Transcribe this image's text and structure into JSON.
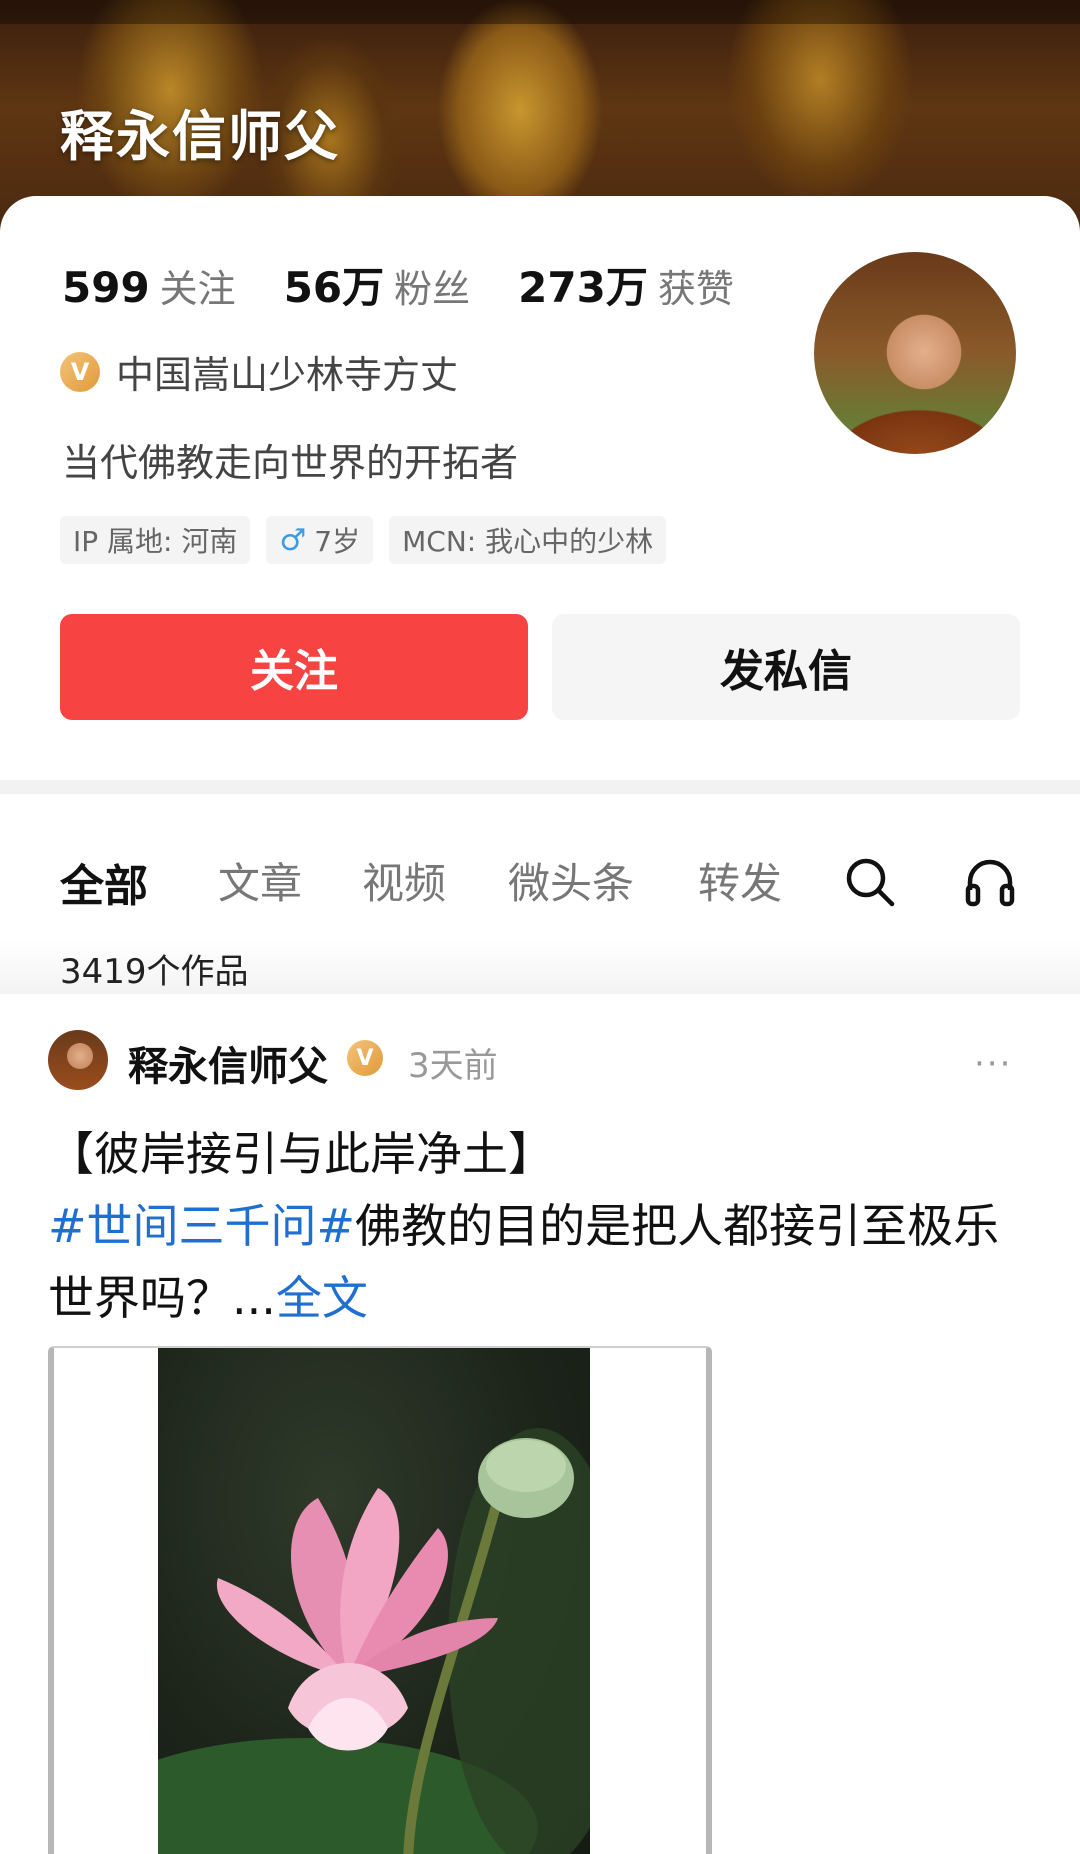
{
  "header": {
    "title": "释永信师父"
  },
  "profile": {
    "stats": [
      {
        "num": "599",
        "label": "关注"
      },
      {
        "num": "56万",
        "label": "粉丝"
      },
      {
        "num": "273万",
        "label": "获赞"
      }
    ],
    "verify_badge": "V",
    "verify_text": "中国嵩山少林寺方丈",
    "bio": "当代佛教走向世界的开拓者",
    "tags": {
      "ip": "IP 属地: 河南",
      "age": "7岁",
      "mcn": "MCN: 我心中的少林"
    },
    "follow_label": "关注",
    "message_label": "发私信"
  },
  "tabs": [
    {
      "label": "全部",
      "active": true
    },
    {
      "label": "文章"
    },
    {
      "label": "视频"
    },
    {
      "label": "微头条"
    },
    {
      "label": "转发"
    }
  ],
  "icons": {
    "search": "search-icon",
    "listen": "headphones-icon",
    "gender": "male-icon",
    "more": "more-icon"
  },
  "works_count": "3419个作品",
  "post": {
    "author": "释永信师父",
    "verify_badge": "V",
    "time": "3天前",
    "more": "···",
    "title": "【彼岸接引与此岸净土】",
    "hashtag": "#世间三千问#",
    "text": "佛教的目的是把人都接引至极乐世界吗？...",
    "full_link": "全文"
  },
  "colors": {
    "accent": "#f84343",
    "link": "#1f6fd1",
    "verified": "#e9a54a"
  }
}
